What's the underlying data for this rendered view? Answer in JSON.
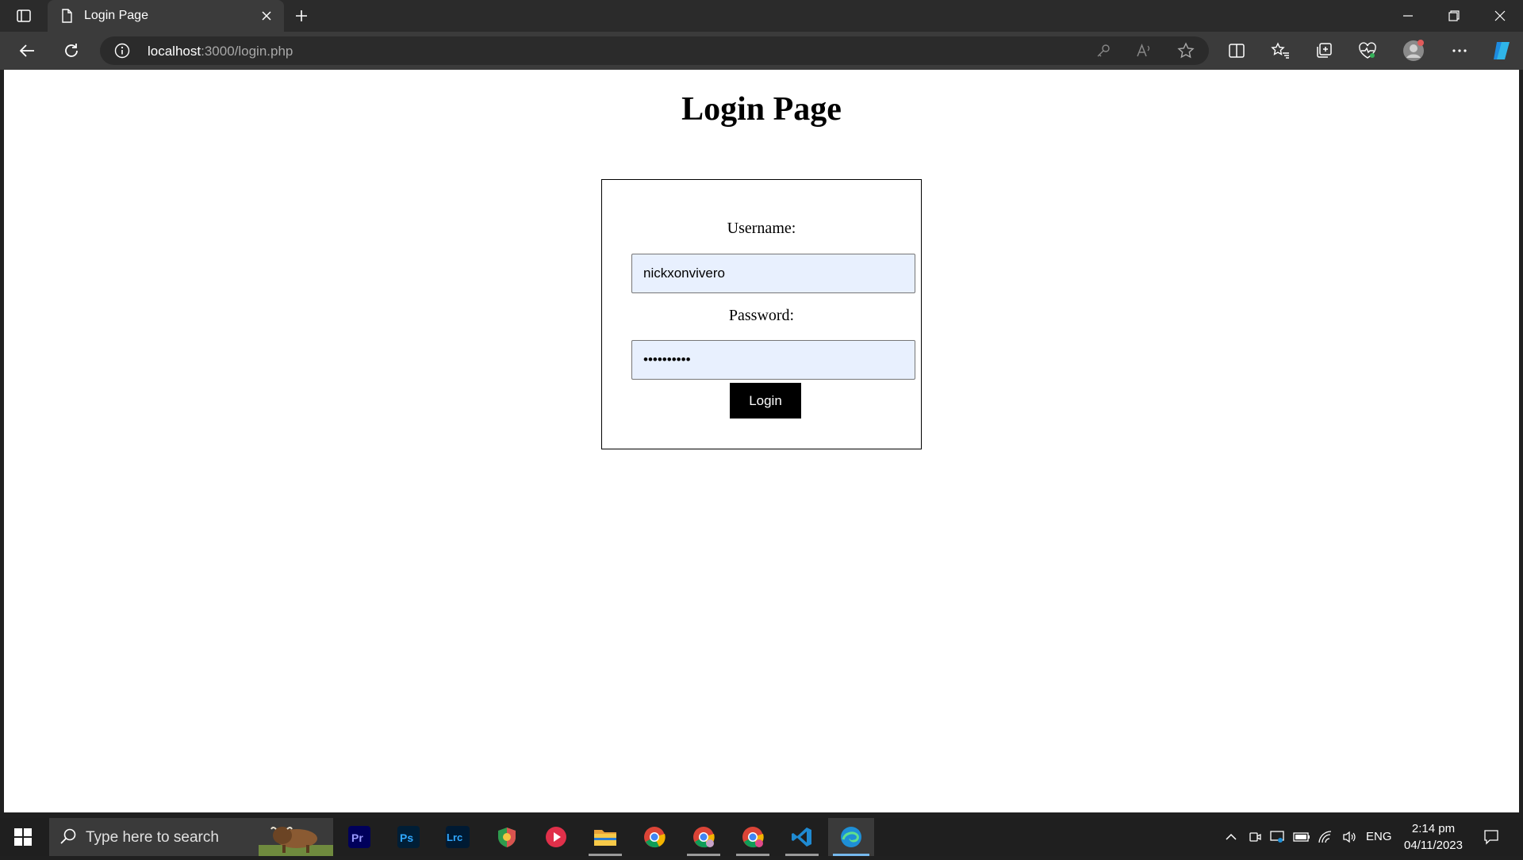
{
  "browser": {
    "tab_title": "Login Page",
    "address": {
      "host": "localhost",
      "path": ":3000/login.php"
    }
  },
  "page": {
    "title": "Login Page",
    "username_label": "Username:",
    "username_value": "nickxonvivero",
    "password_label": "Password:",
    "password_value": "••••••••••",
    "login_label": "Login"
  },
  "taskbar": {
    "search_placeholder": "Type here to search",
    "apps": [
      "premiere-pro",
      "photoshop",
      "lightroom-classic",
      "security-app",
      "media-player",
      "file-explorer",
      "chrome",
      "chrome-profile-1",
      "chrome-profile-2",
      "vscode",
      "edge"
    ],
    "language": "ENG",
    "time": "2:14 pm",
    "date": "04/11/2023"
  },
  "colors": {
    "accent": "#76b9ed",
    "input_bg": "#e8f0fe",
    "button_bg": "#000000"
  }
}
